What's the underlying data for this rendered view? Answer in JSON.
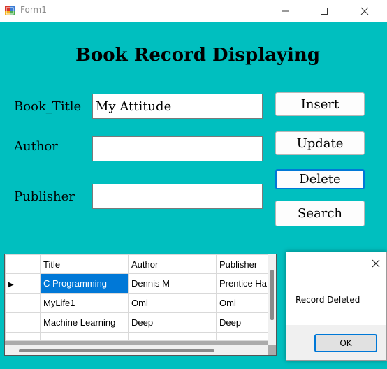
{
  "window": {
    "title": "Form1",
    "background_color": "#00bfbf",
    "icon": "windows-form-icon"
  },
  "form": {
    "heading": "Book Record Displaying",
    "fields": {
      "book_title": {
        "label": "Book_Title",
        "value": "My Attitude"
      },
      "author": {
        "label": "Author",
        "value": ""
      },
      "publisher": {
        "label": "Publisher",
        "value": ""
      }
    },
    "buttons": {
      "insert": "Insert",
      "update": "Update",
      "delete": "Delete",
      "search": "Search"
    }
  },
  "grid": {
    "columns": [
      "Title",
      "Author",
      "Publisher"
    ],
    "rows": [
      {
        "title": "C Programming",
        "author": "Dennis M",
        "publisher": "Prentice Ha",
        "current": true
      },
      {
        "title": "MyLife1",
        "author": "Omi",
        "publisher": "Omi",
        "current": false
      },
      {
        "title": "Machine Learning",
        "author": "Deep",
        "publisher": "Deep",
        "current": false
      }
    ],
    "current_row_marker": "▶"
  },
  "message_box": {
    "text": "Record Deleted",
    "ok_label": "OK"
  },
  "colors": {
    "selection": "#0078d7",
    "focus_border": "#0078d7"
  }
}
